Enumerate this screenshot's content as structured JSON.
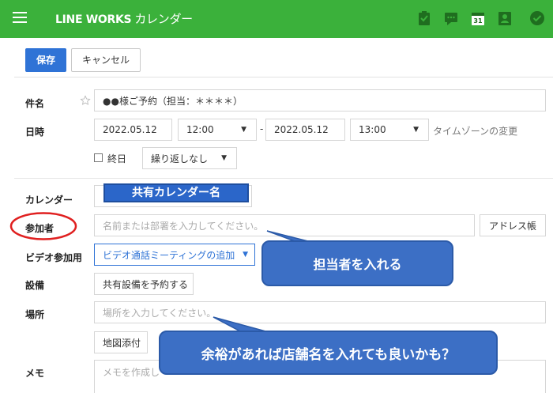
{
  "app": {
    "brand": "LINE WORKS",
    "title": "カレンダー"
  },
  "toolbar": {
    "save_label": "保存",
    "cancel_label": "キャンセル"
  },
  "form": {
    "subject": {
      "label": "件名",
      "value": "●●様ご予約（担当：＊＊＊＊）"
    },
    "datetime": {
      "label": "日時",
      "start_date": "2022.05.12",
      "start_time": "12:00",
      "dash": "-",
      "end_date": "2022.05.12",
      "end_time": "13:00",
      "timezone_link": "タイムゾーンの変更"
    },
    "allday": {
      "label": "終日",
      "repeat": "繰り返しなし"
    },
    "calendar": {
      "label": "カレンダー",
      "value": "共有カレンダー名"
    },
    "attendees": {
      "label": "参加者",
      "placeholder": "名前または部署を入力してください。",
      "address_book": "アドレス帳"
    },
    "video": {
      "label": "ビデオ参加用",
      "value": "ビデオ通話ミーティングの追加"
    },
    "equipment": {
      "label": "設備",
      "button": "共有設備を予約する"
    },
    "location": {
      "label": "場所",
      "placeholder": "場所を入力してください。",
      "map_button": "地図添付"
    },
    "memo": {
      "label": "メモ",
      "placeholder": "メモを作成し"
    }
  },
  "annotations": {
    "callout_attendee": "担当者を入れる",
    "callout_location": "余裕があれば店舗名を入れても良いかも？"
  },
  "colors": {
    "topbar": "#3bb13b",
    "primary": "#2f73d6",
    "callout": "#3c6fc5",
    "highlight_circle": "#e02020",
    "calendar_badge": "#2b66c9"
  }
}
